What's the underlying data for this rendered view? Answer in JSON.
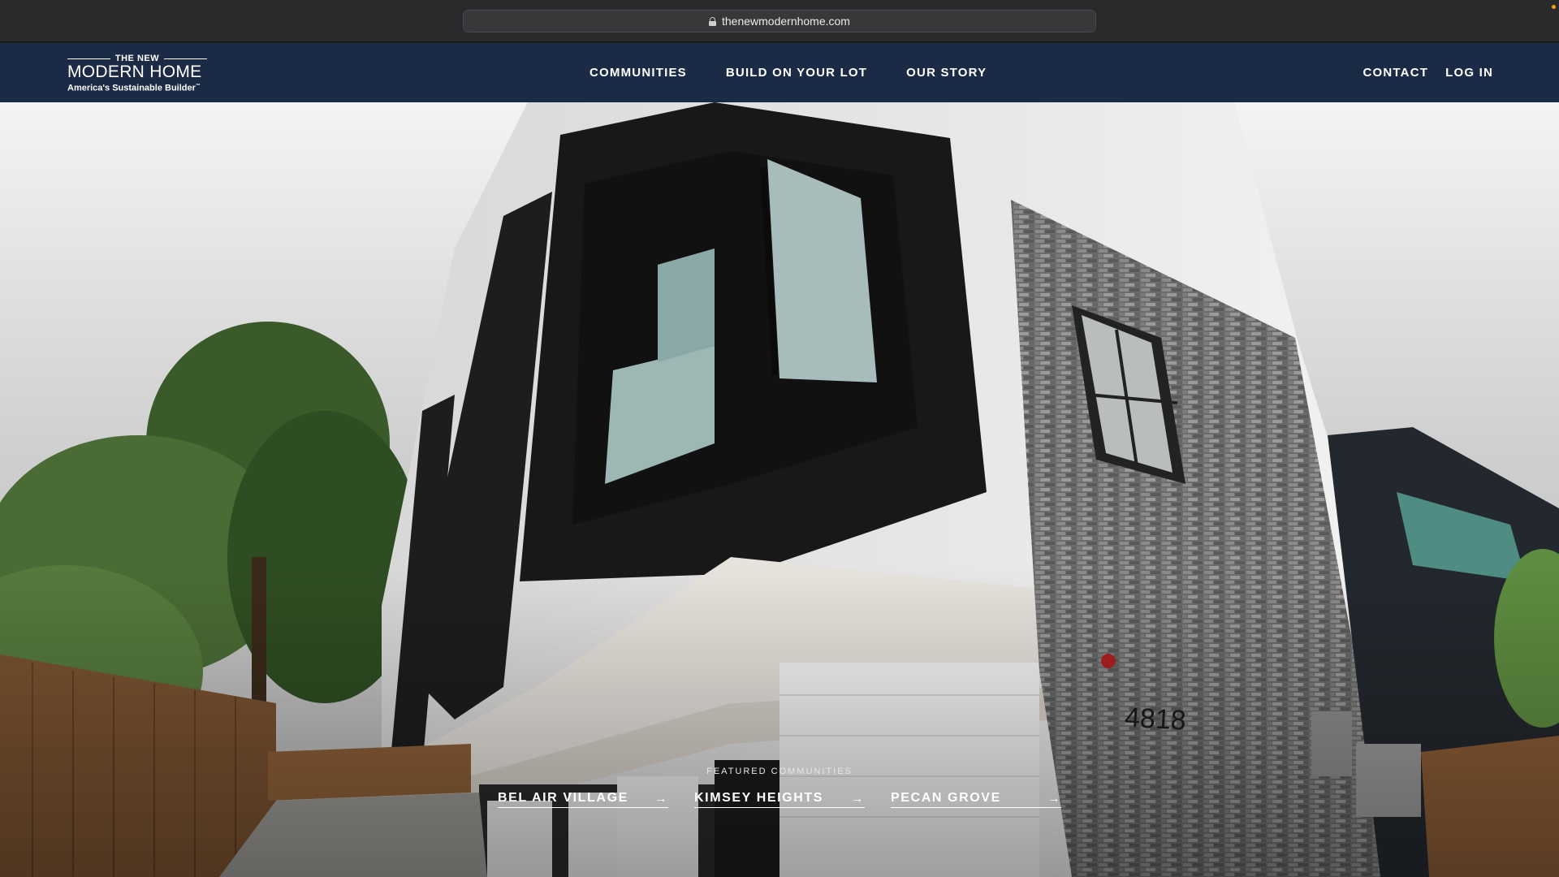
{
  "browser": {
    "url": "thenewmodernhome.com"
  },
  "logo": {
    "top_line": "THE NEW",
    "main": "MODERN HOME",
    "tagline": "America's Sustainable Builder",
    "tm": "™"
  },
  "nav": {
    "communities": "COMMUNITIES",
    "build_on_your_lot": "BUILD ON YOUR LOT",
    "our_story": "OUR STORY",
    "contact": "CONTACT",
    "log_in": "LOG IN"
  },
  "hero": {
    "house_number": "4818",
    "featured_label": "FEATURED COMMUNITIES",
    "communities": [
      {
        "label": "BEL AIR VILLAGE",
        "icon": "arrow-right-icon"
      },
      {
        "label": "KIMSEY HEIGHTS",
        "icon": "arrow-right-icon"
      },
      {
        "label": "PECAN GROVE",
        "icon": "arrow-right-icon"
      }
    ]
  },
  "colors": {
    "header_bg": "#1c2b45",
    "chrome_bg": "#2a2a2c",
    "text_white": "#ffffff"
  }
}
